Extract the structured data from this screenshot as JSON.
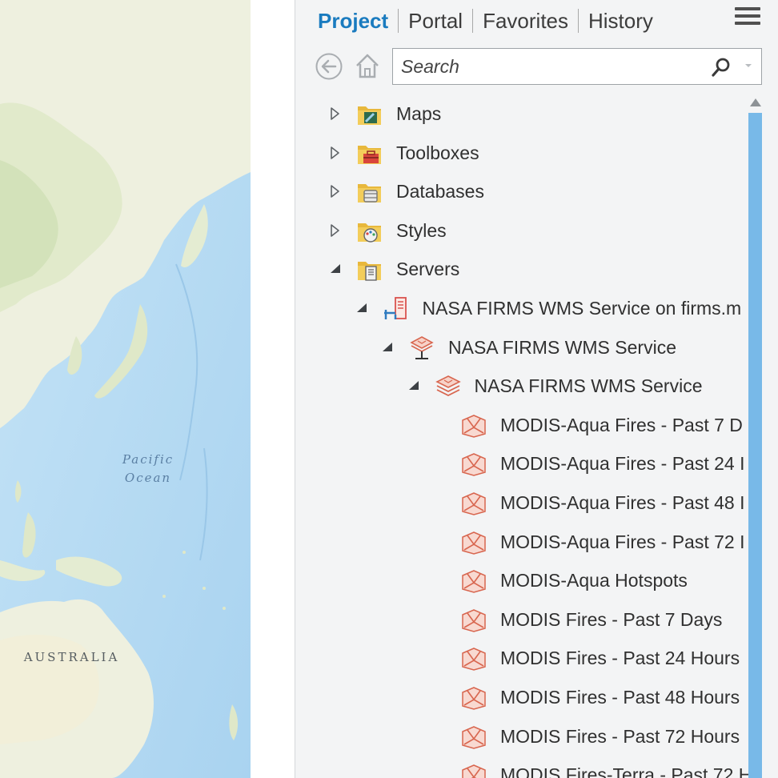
{
  "map": {
    "labels": {
      "ocean_line1": "Pacific",
      "ocean_line2": "Ocean",
      "continent": "AUSTRALIA"
    }
  },
  "tabs": [
    {
      "label": "Project",
      "active": true
    },
    {
      "label": "Portal",
      "active": false
    },
    {
      "label": "Favorites",
      "active": false
    },
    {
      "label": "History",
      "active": false
    }
  ],
  "search": {
    "placeholder": "Search",
    "value": ""
  },
  "tree": [
    {
      "label": "Maps",
      "depth": 0,
      "state": "collapsed",
      "icon": "maps-folder-icon"
    },
    {
      "label": "Toolboxes",
      "depth": 0,
      "state": "collapsed",
      "icon": "toolbox-folder-icon"
    },
    {
      "label": "Databases",
      "depth": 0,
      "state": "collapsed",
      "icon": "database-folder-icon"
    },
    {
      "label": "Styles",
      "depth": 0,
      "state": "collapsed",
      "icon": "styles-folder-icon"
    },
    {
      "label": "Servers",
      "depth": 0,
      "state": "expanded",
      "icon": "servers-folder-icon"
    },
    {
      "label": "NASA FIRMS WMS Service on firms.m",
      "depth": 1,
      "state": "expanded",
      "icon": "server-connection-icon"
    },
    {
      "label": "NASA FIRMS WMS Service",
      "depth": 2,
      "state": "expanded",
      "icon": "wms-service-icon"
    },
    {
      "label": "NASA FIRMS WMS Service",
      "depth": 3,
      "state": "expanded",
      "icon": "wms-layers-icon"
    },
    {
      "label": "MODIS-Aqua Fires - Past 7 D",
      "depth": 4,
      "state": "leaf",
      "icon": "wms-layer-icon"
    },
    {
      "label": "MODIS-Aqua Fires - Past 24 I",
      "depth": 4,
      "state": "leaf",
      "icon": "wms-layer-icon"
    },
    {
      "label": "MODIS-Aqua Fires - Past 48 I",
      "depth": 4,
      "state": "leaf",
      "icon": "wms-layer-icon"
    },
    {
      "label": "MODIS-Aqua Fires - Past 72 I",
      "depth": 4,
      "state": "leaf",
      "icon": "wms-layer-icon"
    },
    {
      "label": "MODIS-Aqua Hotspots",
      "depth": 4,
      "state": "leaf",
      "icon": "wms-layer-icon"
    },
    {
      "label": "MODIS Fires - Past 7 Days",
      "depth": 4,
      "state": "leaf",
      "icon": "wms-layer-icon"
    },
    {
      "label": "MODIS Fires - Past 24 Hours",
      "depth": 4,
      "state": "leaf",
      "icon": "wms-layer-icon"
    },
    {
      "label": "MODIS Fires - Past 48 Hours",
      "depth": 4,
      "state": "leaf",
      "icon": "wms-layer-icon"
    },
    {
      "label": "MODIS Fires - Past 72 Hours",
      "depth": 4,
      "state": "leaf",
      "icon": "wms-layer-icon"
    },
    {
      "label": "MODIS Fires-Terra - Past 72 H",
      "depth": 4,
      "state": "leaf",
      "icon": "wms-layer-icon"
    }
  ],
  "colors": {
    "active_tab": "#1a7bbf",
    "scroll_thumb": "#78b9e8",
    "pane_bg": "#f3f4f5",
    "ocean": "#b9dcf3",
    "land": "#eef0df"
  }
}
